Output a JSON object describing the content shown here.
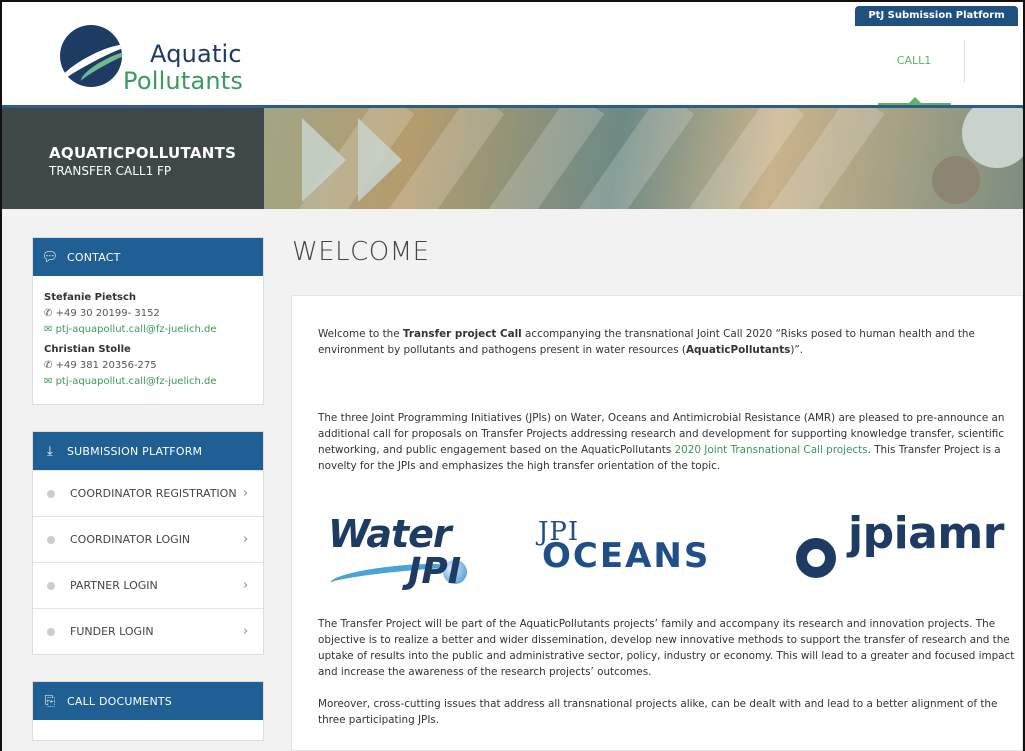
{
  "header": {
    "logo_line1": "Aquatic",
    "logo_line2": "Pollutants",
    "ptj_button": "PtJ Submission Platform",
    "nav_call": "CALL1"
  },
  "banner": {
    "title": "AQUATICPOLLUTANTS",
    "subtitle": "TRANSFER CALL1 FP"
  },
  "sidebar": {
    "contact": {
      "heading": "CONTACT",
      "people": [
        {
          "name": "Stefanie Pietsch",
          "phone": "+49 30 20199- 3152",
          "email": "ptj-aquapollut.call@fz-juelich.de"
        },
        {
          "name": "Christian Stolle",
          "phone": "+49 381 20356-275",
          "email": "ptj-aquapollut.call@fz-juelich.de"
        }
      ]
    },
    "submission": {
      "heading": "SUBMISSION PLATFORM",
      "items": [
        {
          "label": "COORDINATOR REGISTRATION"
        },
        {
          "label": "COORDINATOR LOGIN"
        },
        {
          "label": "PARTNER LOGIN"
        },
        {
          "label": "FUNDER LOGIN"
        }
      ]
    },
    "documents": {
      "heading": "CALL DOCUMENTS"
    }
  },
  "main": {
    "title": "WELCOME",
    "p1_a": "Welcome to the ",
    "p1_b": "Transfer project Call",
    "p1_c": " accompanying the transnational Joint Call 2020 “Risks posed to human health and the environment by pollutants and pathogens present in water resources (",
    "p1_d": "AquaticPollutants",
    "p1_e": ")”.",
    "p2_a": "The three Joint Programming Initiatives (JPIs) on Water, Oceans and Antimicrobial Resistance (AMR) are pleased to pre-announce an additional call for proposals on Transfer Projects addressing research and development for supporting knowledge transfer, scientific networking, and public engagement based on the AquaticPollutants ",
    "p2_link": "2020 Joint Transnational Call projects",
    "p2_b": ". This Transfer Project is a novelty for the JPIs and emphasizes the high transfer orientation of the topic.",
    "logos": {
      "water_word": "Water",
      "water_jpi": "JPI",
      "oceans_jpi": "JPI",
      "oceans_word": "OCEANS",
      "amr_word": "jpiamr"
    },
    "p3": "The Transfer Project will be part of the AquaticPollutants projects’ family and accompany its research and innovation projects. The objective is to realize a better and wider dissemination, develop new innovative methods to support the transfer of research and the uptake of results into the public and administrative sector, policy, industry or economy. This will lead to a greater and focused impact and increase the awareness of the research projects’ outcomes.",
    "p4": "Moreover, cross-cutting issues that address all transnational projects alike, can be dealt with and lead to a better alignment of the three participating JPIs."
  },
  "colors": {
    "brand_blue": "#1f5f93",
    "brand_green": "#3a9a56",
    "dark_panel": "#3e4848"
  }
}
